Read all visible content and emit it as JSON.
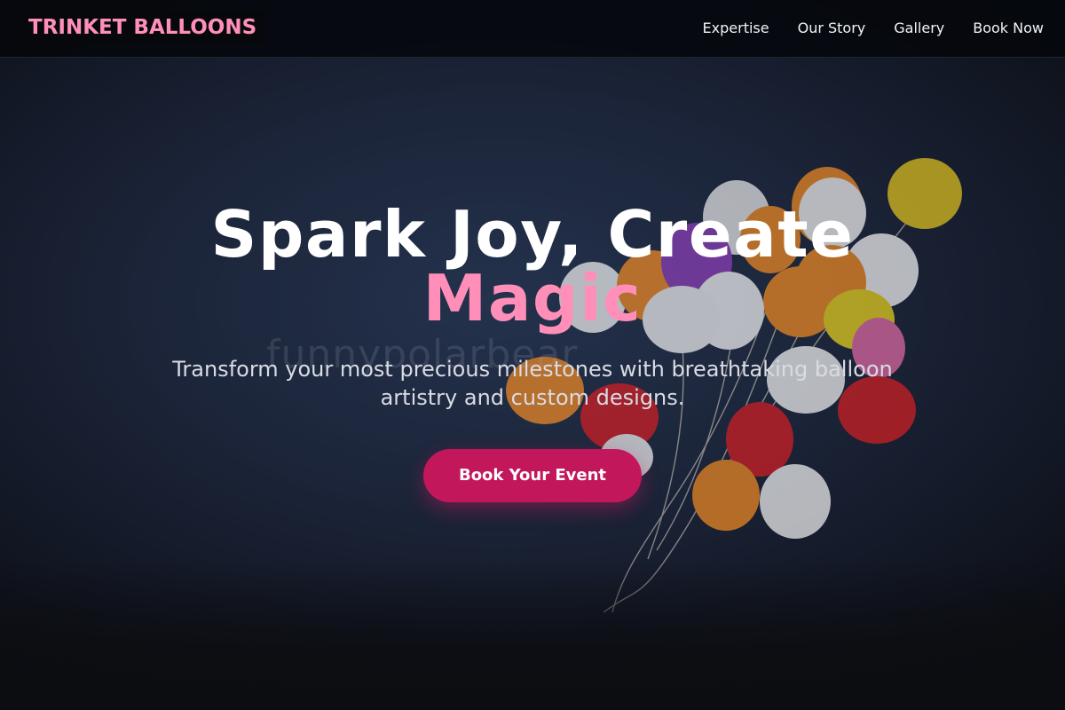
{
  "brand": {
    "name": "TRINKET BALLOONS"
  },
  "nav": {
    "links": [
      {
        "label": "Expertise"
      },
      {
        "label": "Our Story"
      },
      {
        "label": "Gallery"
      },
      {
        "label": "Book Now"
      }
    ]
  },
  "hero": {
    "title_line1": "Spark Joy, Create",
    "title_accent": "Magic",
    "subtitle": "Transform your most precious milestones with breathtaking balloon artistry and custom designs.",
    "cta_label": "Book Your Event",
    "watermark": "funnypolarbear"
  },
  "colors": {
    "accent_pink": "#ff8fb8",
    "cta_background": "#c2185b",
    "background_navy": "#1b2438"
  }
}
